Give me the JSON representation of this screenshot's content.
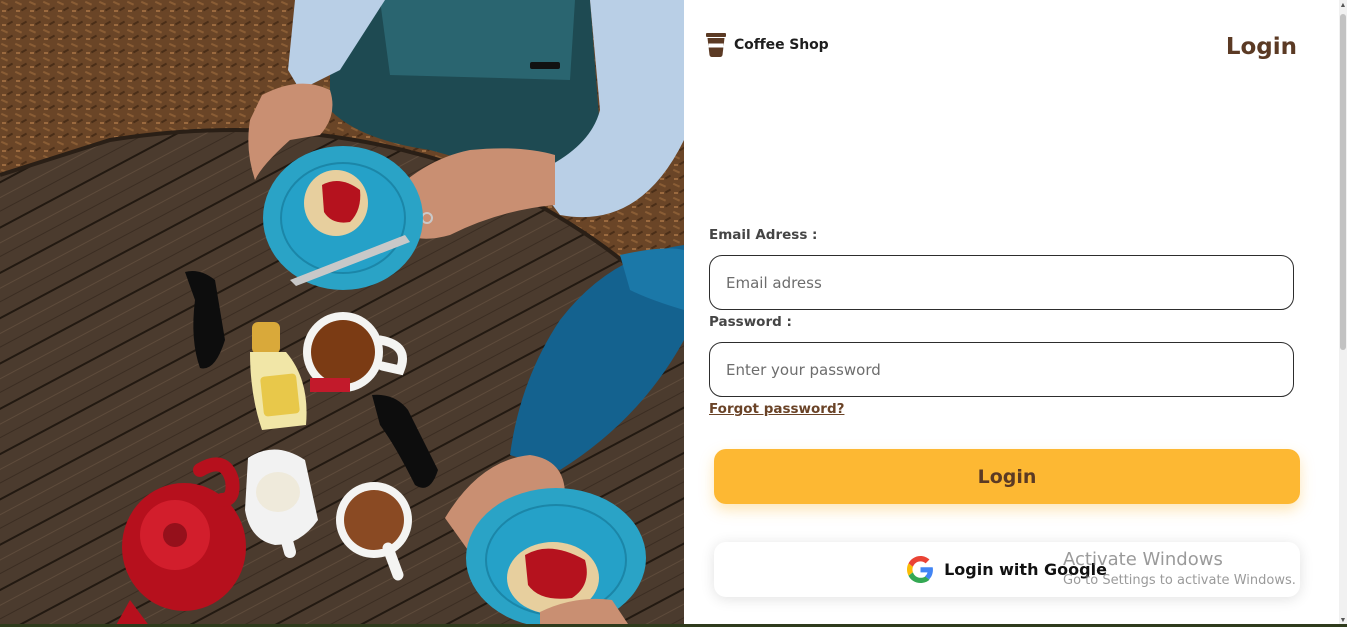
{
  "brand": {
    "name": "Coffee Shop",
    "icon": "coffee-cup-icon",
    "color": "#5b3a24"
  },
  "page": {
    "title": "Login"
  },
  "form": {
    "email": {
      "label": "Email Adress :",
      "placeholder": "Email adress",
      "value": ""
    },
    "password": {
      "label": "Password :",
      "placeholder": "Enter your password",
      "value": ""
    },
    "forgot_link": "Forgot password?",
    "login_button": "Login",
    "google_button": {
      "label": "Login with Google",
      "icon": "google-g-icon"
    }
  },
  "colors": {
    "accent": "#fdb833",
    "brand_brown": "#5b3a24"
  },
  "watermark": {
    "title": "Activate Windows",
    "subtitle": "Go to Settings to activate Windows."
  },
  "hero_image": {
    "icon": "photo-overhead-cafe-table"
  }
}
